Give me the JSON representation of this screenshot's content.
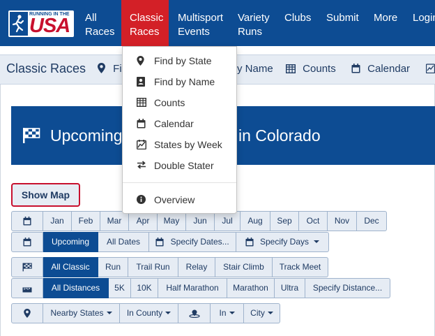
{
  "logo": {
    "line1": "RUNNING IN THE",
    "line2": "USA"
  },
  "topnav": [
    {
      "line1": "All",
      "line2": "Races"
    },
    {
      "line1": "Classic",
      "line2": "Races"
    },
    {
      "line1": "Multisport",
      "line2": "Events"
    },
    {
      "line1": "Variety",
      "line2": "Runs"
    },
    {
      "line1": "Clubs",
      "line2": ""
    },
    {
      "line1": "Submit",
      "line2": ""
    },
    {
      "line1": "More",
      "line2": ""
    },
    {
      "line1": "Login",
      "line2": ""
    }
  ],
  "subnav": {
    "title": "Classic Races",
    "find_state_partial": "Fi",
    "find_name_partial": "y Name",
    "counts": "Counts",
    "calendar": "Calendar"
  },
  "dropdown": [
    {
      "label": "Find by State",
      "icon": "map-marker-icon"
    },
    {
      "label": "Find by Name",
      "icon": "id-badge-icon"
    },
    {
      "label": "Counts",
      "icon": "table-icon"
    },
    {
      "label": "Calendar",
      "icon": "calendar-icon"
    },
    {
      "label": "States by Week",
      "icon": "map-calendar-icon"
    },
    {
      "label": "Double Stater",
      "icon": "exchange-icon"
    },
    {
      "label": "Overview",
      "icon": "info-circle-icon"
    }
  ],
  "banner": {
    "left_text": "Upcoming",
    "right_text": "in Colorado"
  },
  "show_map": "Show Map",
  "months": [
    "Jan",
    "Feb",
    "Mar",
    "Apr",
    "May",
    "Jun",
    "Jul",
    "Aug",
    "Sep",
    "Oct",
    "Nov",
    "Dec"
  ],
  "dates": {
    "upcoming": "Upcoming",
    "all": "All Dates",
    "specify_dates": "Specify Dates...",
    "specify_days": "Specify Days"
  },
  "types": [
    "All Classic",
    "Run",
    "Trail Run",
    "Relay",
    "Stair Climb",
    "Track Meet"
  ],
  "distances": [
    "All Distances",
    "5K",
    "10K",
    "Half Marathon",
    "Marathon",
    "Ultra",
    "Specify Distance..."
  ],
  "location": {
    "nearby": "Nearby States",
    "county": "In County",
    "in": "In",
    "city": "City"
  },
  "colors": {
    "brand_blue": "#0d4c93",
    "active_red": "#d32027",
    "light": "#e6ecf4"
  }
}
